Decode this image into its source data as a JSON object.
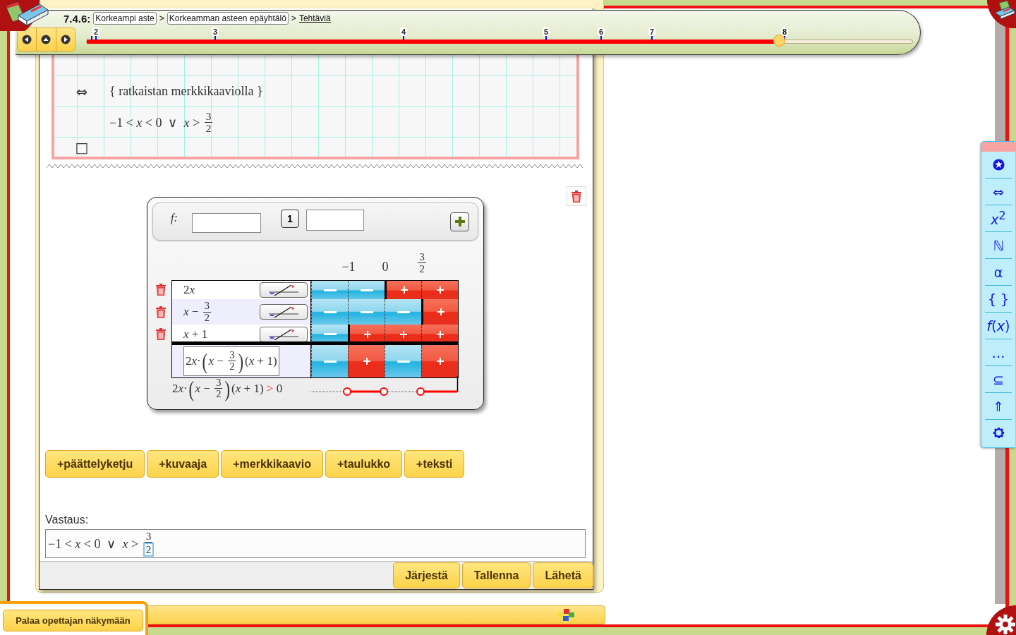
{
  "header": {
    "section": "7.4.6:",
    "breadcrumbs": [
      {
        "kind": "box",
        "label": "Korkeampi aste"
      },
      {
        "kind": "sep",
        "label": ">"
      },
      {
        "kind": "box",
        "label": "Korkeamman asteen epäyhtälö"
      },
      {
        "kind": "sep",
        "label": ">"
      },
      {
        "kind": "link",
        "label": "Tehtäviä"
      }
    ],
    "timeline": {
      "ticks": [
        "2",
        "3",
        "4",
        "5",
        "6",
        "7",
        "8"
      ],
      "level": 0.839
    }
  },
  "worksheet": {
    "steps": [
      {
        "symbol": "⇔",
        "math": [
          {
            "t": "{ ratkaistan merkkikaaviolla }"
          }
        ]
      },
      {
        "math": [
          {
            "t": "−1 < *x* < 0  ∨  *x* > "
          },
          {
            "num": "3",
            "den": "2"
          }
        ]
      },
      {
        "symbol": "□"
      }
    ]
  },
  "sign_chart": {
    "f_label": "f:",
    "count": "1",
    "critical_points": [
      {
        "t": "−1"
      },
      {
        "t": "0"
      },
      {
        "num": "3",
        "den": "2"
      }
    ],
    "factors": [
      {
        "math": [
          {
            "t": "2"
          },
          {
            "v": "x"
          }
        ],
        "selected": false,
        "positive": [
          false,
          false,
          true,
          true
        ]
      },
      {
        "math": [
          {
            "t": "*x* − "
          },
          {
            "num": "3",
            "den": "2"
          }
        ],
        "selected": true,
        "positive": [
          false,
          false,
          false,
          true
        ]
      },
      {
        "math": [
          {
            "t": "*x* + 1"
          }
        ],
        "selected": false,
        "positive": [
          false,
          true,
          true,
          true
        ]
      }
    ],
    "product": {
      "math": [
        {
          "t": "2"
        },
        {
          "v": "x"
        },
        {
          "t": "·"
        },
        {
          "big": "("
        },
        {
          "t": "*x* − "
        },
        {
          "num": "3",
          "den": "2"
        },
        {
          "big": ")"
        },
        {
          "t": "(*x* + 1)"
        }
      ],
      "positive": [
        false,
        true,
        false,
        true
      ]
    },
    "inequality": [
      {
        "t": "2"
      },
      {
        "v": "x"
      },
      {
        "t": "·"
      },
      {
        "big": "("
      },
      {
        "t": "*x* − "
      },
      {
        "num": "3",
        "den": "2"
      },
      {
        "big": ")"
      },
      {
        "t": "(*x* + 1) "
      },
      {
        "t": ">",
        "highlight": true
      },
      {
        "t": " 0"
      }
    ]
  },
  "add_buttons": [
    "+päättelyketju",
    "+kuvaaja",
    "+merkkikaavio",
    "+taulukko",
    "+teksti"
  ],
  "answer": {
    "label": "Vastaus:",
    "math": [
      {
        "t": "−1 < *x* < 0  ∨  *x* > "
      },
      {
        "num": "3",
        "den": "2",
        "cursor": true
      }
    ]
  },
  "footer_buttons": [
    "Järjestä",
    "Tallenna",
    "Lähetä"
  ],
  "back_button": "Palaa opettajan näkymään",
  "toolbar": [
    {
      "kind": "star"
    },
    {
      "kind": "text",
      "label": "⇔"
    },
    {
      "kind": "text",
      "label": "*x*$^{2}$"
    },
    {
      "kind": "text",
      "label": "ℕ"
    },
    {
      "kind": "text",
      "label": "α"
    },
    {
      "kind": "text",
      "label": "{ }"
    },
    {
      "kind": "text",
      "label": "*f*(*x*)"
    },
    {
      "kind": "text",
      "label": "…"
    },
    {
      "kind": "text",
      "label": "⊆"
    },
    {
      "kind": "text",
      "label": "⇑"
    },
    {
      "kind": "gear"
    }
  ]
}
